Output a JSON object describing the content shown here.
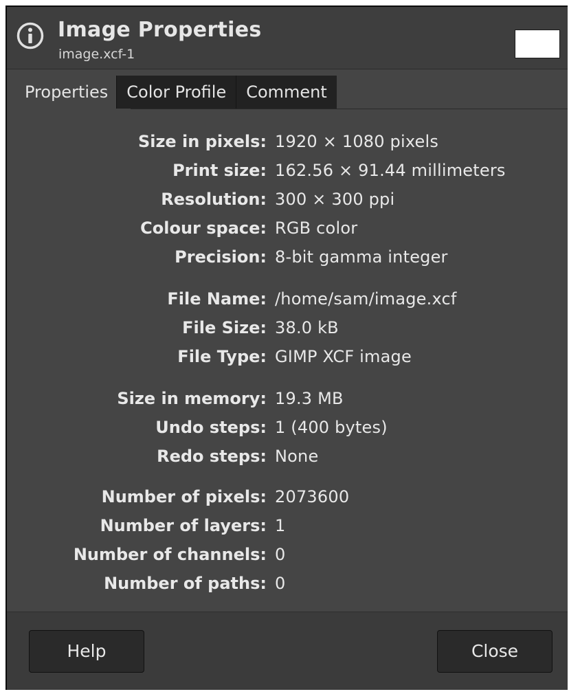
{
  "header": {
    "title": "Image Properties",
    "subtitle": "image.xcf-1",
    "icon": "info-icon"
  },
  "tabs": [
    {
      "label": "Properties",
      "active": true
    },
    {
      "label": "Color Profile",
      "active": false
    },
    {
      "label": "Comment",
      "active": false
    }
  ],
  "properties": [
    {
      "label": "Size in pixels:",
      "value": "1920 × 1080 pixels"
    },
    {
      "label": "Print size:",
      "value": "162.56 × 91.44 millimeters"
    },
    {
      "label": "Resolution:",
      "value": "300 × 300 ppi"
    },
    {
      "label": "Colour space:",
      "value": "RGB color"
    },
    {
      "label": "Precision:",
      "value": "8-bit gamma integer"
    },
    {
      "label": "File Name:",
      "value": "/home/sam/image.xcf"
    },
    {
      "label": "File Size:",
      "value": "38.0 kB"
    },
    {
      "label": "File Type:",
      "value": "GIMP XCF image"
    },
    {
      "label": "Size in memory:",
      "value": "19.3 MB"
    },
    {
      "label": "Undo steps:",
      "value": "1 (400 bytes)"
    },
    {
      "label": "Redo steps:",
      "value": "None"
    },
    {
      "label": "Number of pixels:",
      "value": "2073600"
    },
    {
      "label": "Number of layers:",
      "value": "1"
    },
    {
      "label": "Number of channels:",
      "value": "0"
    },
    {
      "label": "Number of paths:",
      "value": "0"
    }
  ],
  "footer": {
    "help_label": "Help",
    "close_label": "Close"
  },
  "colors": {
    "dialog_bg": "#454545",
    "header_bg": "#3e3e3e",
    "tab_inactive_bg": "#222222",
    "text": "#e8e8e8"
  }
}
